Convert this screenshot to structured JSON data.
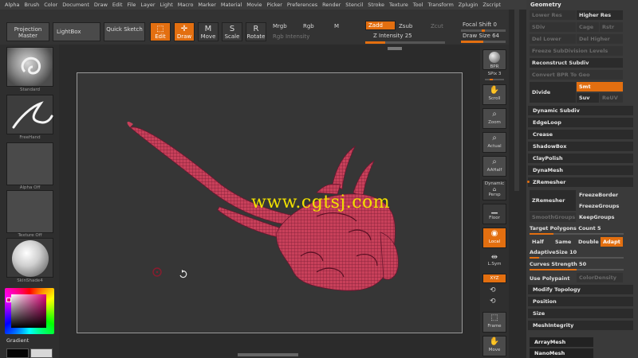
{
  "menu": [
    "Alpha",
    "Brush",
    "Color",
    "Document",
    "Draw",
    "Edit",
    "File",
    "Layer",
    "Light",
    "Macro",
    "Marker",
    "Material",
    "Movie",
    "Picker",
    "Preferences",
    "Render",
    "Stencil",
    "Stroke",
    "Texture",
    "Tool",
    "Transform",
    "Zplugin",
    "Zscript"
  ],
  "toolbar": {
    "projection_master": "Projection Master",
    "lightbox": "LightBox",
    "quick_sketch": "Quick Sketch",
    "edit": "Edit",
    "draw": "Draw",
    "move": "Move",
    "scale": "Scale",
    "rotate": "Rotate",
    "mrgb": "Mrgb",
    "rgb": "Rgb",
    "m": "M",
    "rgb_intensity": "Rgb Intensity",
    "zadd": "Zadd",
    "zsub": "Zsub",
    "zcut": "Zcut",
    "z_intensity": "Z Intensity 25",
    "focal_shift": "Focal Shift 0",
    "draw_size": "Draw Size 64",
    "z_intensity_value": 25,
    "focal_shift_value": 0,
    "draw_size_value": 64
  },
  "leftshelf": {
    "standard": "Standard",
    "freehand": "FreeHand",
    "alpha_off": "Alpha Off",
    "texture_off": "Texture Off",
    "material": "SkinShade4",
    "gradient": "Gradient"
  },
  "watermark": "www.cgtsj.com",
  "rightcol": {
    "bpr": "BPR",
    "spix": "SPix 3",
    "scroll": "Scroll",
    "zoom": "Zoom",
    "actual": "Actual",
    "aahalf": "AAHalf",
    "dynamic": "Dynamic",
    "persp": "Persp",
    "floor": "Floor",
    "local": "Local",
    "lsym": "L.Sym",
    "xyz": "XYZ",
    "frame": "Frame",
    "move": "Move"
  },
  "geometry": {
    "title": "Geometry",
    "lower_res": "Lower Res",
    "higher_res": "Higher Res",
    "sdiv": "SDiv",
    "cage": "Cage",
    "rstr": "Rstr",
    "del_lower": "Del Lower",
    "del_higher": "Del Higher",
    "freeze_subdiv": "Freeze SubDivision Levels",
    "reconstruct_subdiv": "Reconstruct Subdiv",
    "convert_bpr": "Convert BPR To Geo",
    "divide": "Divide",
    "smt": "Smt",
    "suv": "Suv",
    "reuv": "ReUV",
    "dynamic_subdiv": "Dynamic Subdiv",
    "edgeloop": "EdgeLoop",
    "crease": "Crease",
    "shadowbox": "ShadowBox",
    "claypolish": "ClayPolish",
    "dynamesh": "DynaMesh",
    "zremesher_section": "ZRemesher",
    "zremesher_btn": "ZRemesher",
    "freeze_border": "FreezeBorder",
    "freeze_groups": "FreezeGroups",
    "smooth_groups": "SmoothGroups",
    "keep_groups": "KeepGroups",
    "target_polys": "Target Polygons Count 5",
    "target_polys_value": 5,
    "half": "Half",
    "same": "Same",
    "double": "Double",
    "adapt": "Adapt",
    "adaptive_size": "AdaptiveSize 10",
    "adaptive_size_value": 10,
    "curves_strength": "Curves Strength 50",
    "curves_strength_value": 50,
    "use_polypaint": "Use Polypaint",
    "color_density": "ColorDensity",
    "modify_topology": "Modify Topology",
    "position": "Position",
    "size": "Size",
    "mesh_integrity": "MeshIntegrity",
    "arraymesh": "ArrayMesh",
    "nanomesh": "NanoMesh"
  },
  "colors": {
    "accent": "#e36f10",
    "mesh": "#c8405a",
    "watermark": "#f0e000"
  }
}
